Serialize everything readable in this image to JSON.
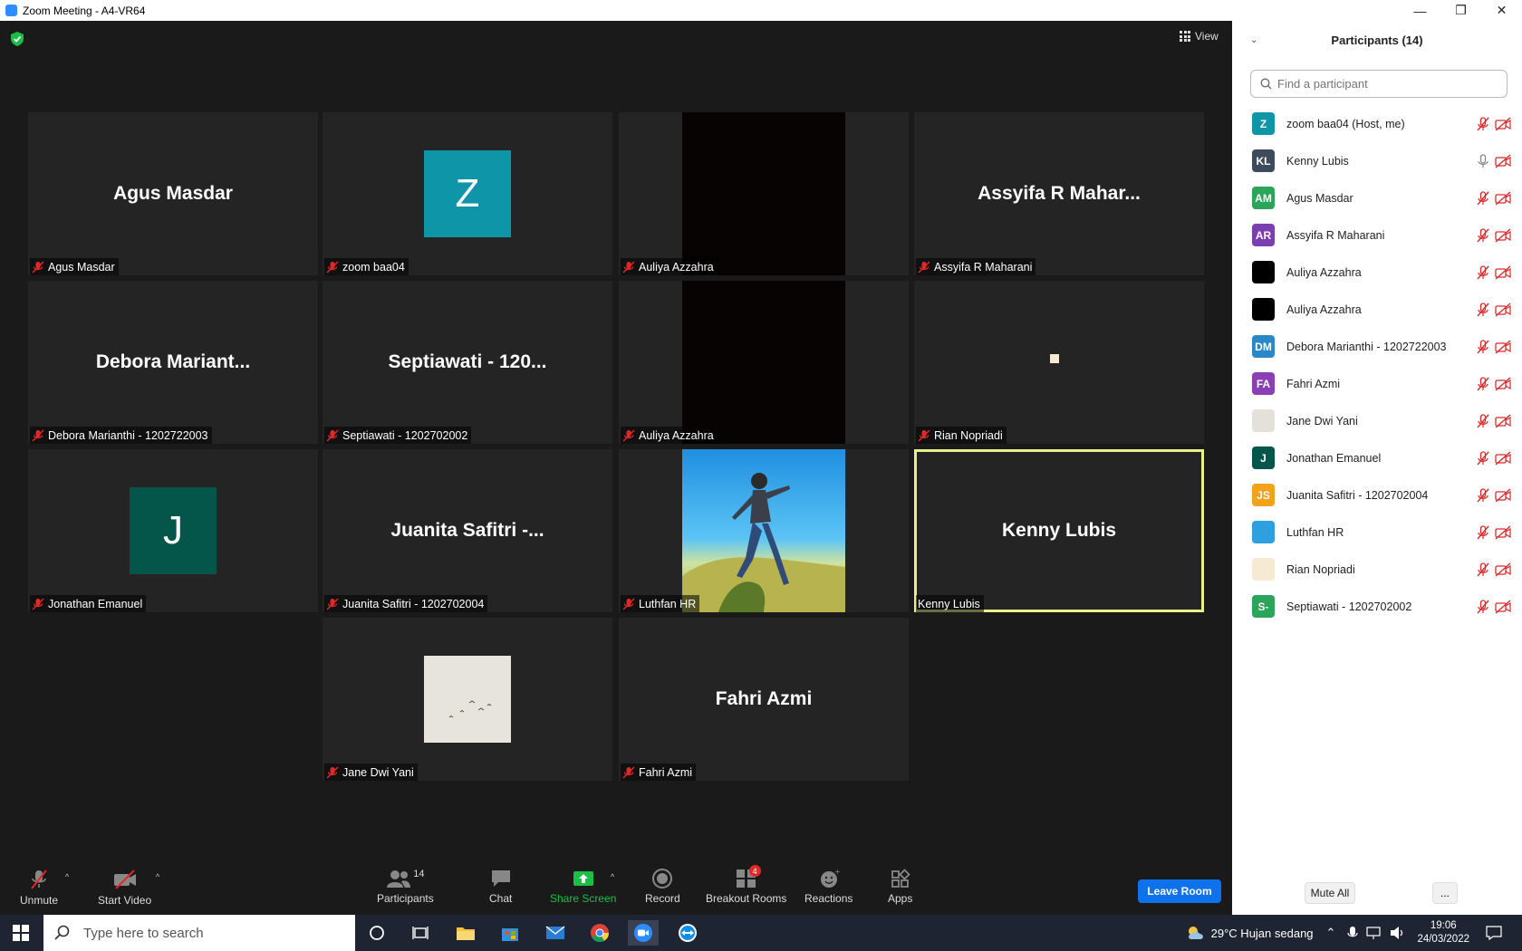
{
  "window": {
    "title": "Zoom Meeting - A4-VR64",
    "minimize": "—",
    "restore": "❐",
    "close": "✕"
  },
  "view_label": "View",
  "tiles": [
    {
      "big": "Agus Masdar",
      "label": "Agus Masdar",
      "muted": true
    },
    {
      "avatar": "Z",
      "avatar_color": "#0e95a8",
      "label": "zoom baa04",
      "muted": true
    },
    {
      "video": "black",
      "label": "Auliya Azzahra",
      "muted": true
    },
    {
      "big": "Assyifa R Mahar...",
      "label": "Assyifa R Maharani",
      "muted": true
    },
    {
      "big": "Debora Mariant...",
      "label": "Debora Marianthi - 1202722003",
      "muted": true
    },
    {
      "big": "Septiawati - 120...",
      "label": "Septiawati - 1202702002",
      "muted": true
    },
    {
      "video": "black",
      "label": "Auliya Azzahra",
      "muted": true
    },
    {
      "label": "Rian Nopriadi",
      "muted": true
    },
    {
      "avatar": "J",
      "avatar_color": "#04554a",
      "label": "Jonathan Emanuel",
      "muted": true
    },
    {
      "big": "Juanita Safitri -...",
      "label": "Juanita Safitri - 1202702004",
      "muted": true
    },
    {
      "video": "photo",
      "label": "Luthfan HR",
      "muted": true
    },
    {
      "big": "Kenny Lubis",
      "label": "Kenny Lubis",
      "muted": false,
      "active": true
    },
    {
      "video": "sky",
      "label": "Jane Dwi Yani",
      "muted": true
    },
    {
      "big": "Fahri Azmi",
      "label": "Fahri Azmi",
      "muted": true
    }
  ],
  "toolbar": {
    "unmute": "Unmute",
    "start_video": "Start Video",
    "participants_count": "14",
    "participants": "Participants",
    "chat": "Chat",
    "share_screen": "Share Screen",
    "record": "Record",
    "breakout_rooms": "Breakout Rooms",
    "breakout_badge": "4",
    "reactions": "Reactions",
    "apps": "Apps",
    "leave_room": "Leave Room"
  },
  "panel": {
    "title": "Participants (14)",
    "search_placeholder": "Find a participant",
    "mute_all": "Mute All",
    "more": "...",
    "participants": [
      {
        "initials": "Z",
        "color": "#0e95a8",
        "name": "zoom baa04 (Host, me)",
        "mic": "muted"
      },
      {
        "initials": "KL",
        "color": "#3e4b5c",
        "name": "Kenny Lubis",
        "mic": "on"
      },
      {
        "initials": "AM",
        "color": "#2aa55a",
        "name": "Agus Masdar",
        "mic": "muted"
      },
      {
        "initials": "AR",
        "color": "#7b3fb0",
        "name": "Assyifa R Maharani",
        "mic": "muted"
      },
      {
        "initials": "",
        "color": "#000000",
        "name": "Auliya Azzahra",
        "mic": "muted"
      },
      {
        "initials": "",
        "color": "#000000",
        "name": "Auliya Azzahra",
        "mic": "muted"
      },
      {
        "initials": "DM",
        "color": "#2a88c9",
        "name": "Debora Marianthi - 1202722003",
        "mic": "muted"
      },
      {
        "initials": "FA",
        "color": "#8a3fb5",
        "name": "Fahri Azmi",
        "mic": "muted"
      },
      {
        "initials": "",
        "color": "#e4e1d8",
        "name": "Jane Dwi Yani",
        "mic": "muted"
      },
      {
        "initials": "J",
        "color": "#04554a",
        "name": "Jonathan Emanuel",
        "mic": "muted"
      },
      {
        "initials": "JS",
        "color": "#f2a31b",
        "name": "Juanita Safitri - 1202702004",
        "mic": "muted"
      },
      {
        "initials": "",
        "color": "#2ea0e0",
        "name": "Luthfan HR",
        "mic": "muted"
      },
      {
        "initials": "",
        "color": "#f7ead2",
        "name": "Rian Nopriadi",
        "mic": "muted"
      },
      {
        "initials": "S-",
        "color": "#2aa55a",
        "name": "Septiawati - 1202702002",
        "mic": "muted"
      }
    ]
  },
  "taskbar": {
    "search_placeholder": "Type here to search",
    "weather": "29°C  Hujan sedang",
    "time": "19:06",
    "date": "24/03/2022"
  },
  "colors": {
    "accent": "#0e72ed",
    "muted_red": "#e02828",
    "active_border": "#e9f08a",
    "share_green": "#1bbf45"
  }
}
